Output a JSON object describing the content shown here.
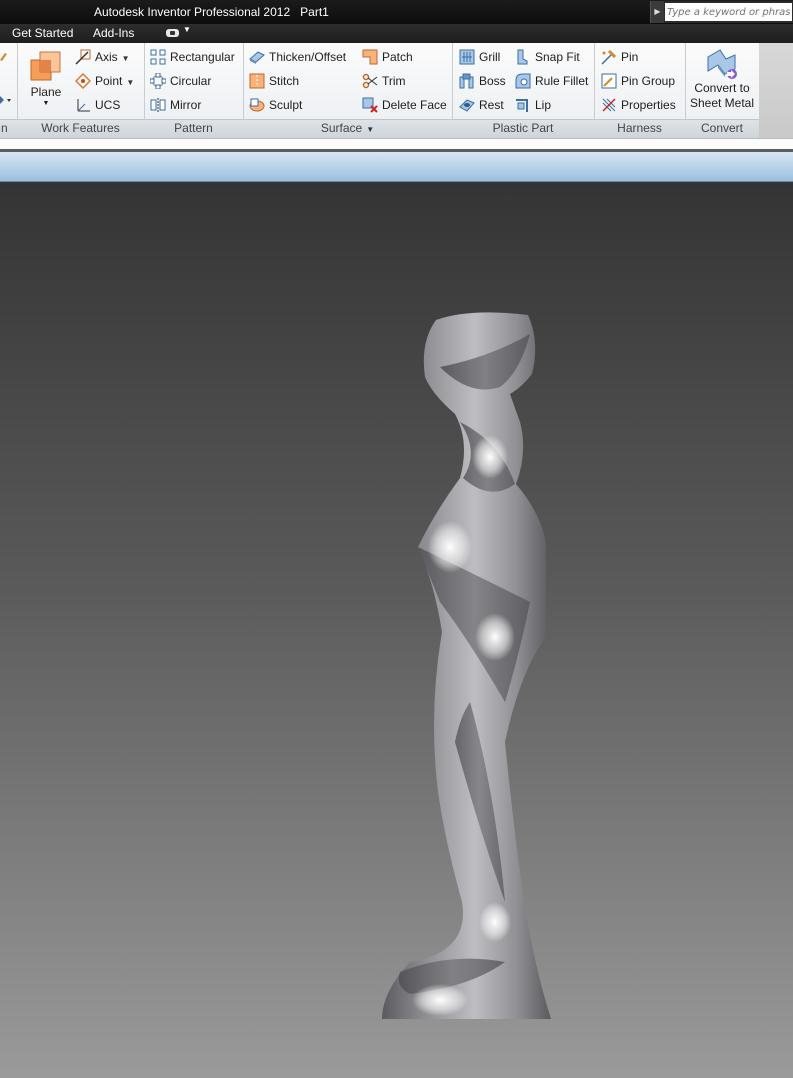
{
  "window": {
    "app_title": "Autodesk Inventor Professional 2012",
    "document_name": "Part1",
    "search_placeholder": "Type a keyword or phrase"
  },
  "tabs": [
    {
      "label": "Get Started"
    },
    {
      "label": "Add-Ins"
    }
  ],
  "ribbon": {
    "clipped_left": {
      "fragment_label": "n"
    },
    "work_features": {
      "label": "Work Features",
      "plane": "Plane",
      "axis": "Axis",
      "point": "Point",
      "ucs": "UCS"
    },
    "pattern": {
      "label": "Pattern",
      "rectangular": "Rectangular",
      "circular": "Circular",
      "mirror": "Mirror"
    },
    "surface": {
      "label": "Surface",
      "thicken_offset": "Thicken/Offset",
      "stitch": "Stitch",
      "sculpt": "Sculpt",
      "patch": "Patch",
      "trim": "Trim",
      "delete_face": "Delete Face"
    },
    "plastic_part": {
      "label": "Plastic Part",
      "grill": "Grill",
      "boss": "Boss",
      "rest": "Rest",
      "snap_fit": "Snap Fit",
      "rule_fillet": "Rule Fillet",
      "lip": "Lip"
    },
    "harness": {
      "label": "Harness",
      "pin": "Pin",
      "pin_group": "Pin Group",
      "properties": "Properties"
    },
    "convert": {
      "label": "Convert",
      "convert_line1": "Convert to",
      "convert_line2": "Sheet Metal"
    }
  },
  "colors": {
    "accent_orange": "#f0a050",
    "ribbon_blue": "#3a6ea5",
    "viewport_top": "#343434",
    "viewport_bottom": "#9a9a9a"
  }
}
